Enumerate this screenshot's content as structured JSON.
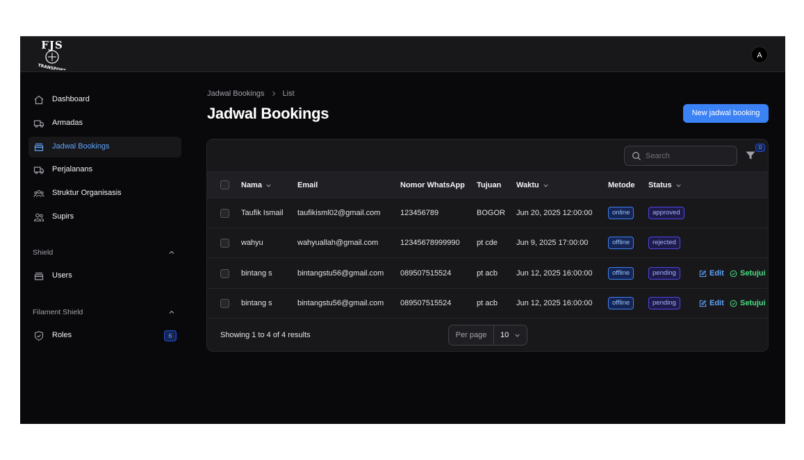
{
  "brand": {
    "logo_main": "FJS",
    "logo_sub": "TRANSPORT"
  },
  "user": {
    "avatar_initial": "A"
  },
  "sidebar": {
    "items": [
      {
        "label": "Dashboard",
        "icon": "home-icon"
      },
      {
        "label": "Armadas",
        "icon": "truck-icon"
      },
      {
        "label": "Jadwal Bookings",
        "icon": "inbox-icon",
        "active": true
      },
      {
        "label": "Perjalanans",
        "icon": "truck-icon"
      },
      {
        "label": "Struktur Organisasis",
        "icon": "users-group-icon"
      },
      {
        "label": "Supirs",
        "icon": "users-icon"
      }
    ],
    "groups": [
      {
        "label": "Shield",
        "items": [
          {
            "label": "Users",
            "icon": "inbox-icon"
          }
        ]
      },
      {
        "label": "Filament Shield",
        "items": [
          {
            "label": "Roles",
            "icon": "shield-check-icon",
            "badge": "6"
          }
        ]
      }
    ]
  },
  "breadcrumb": {
    "parent": "Jadwal Bookings",
    "current": "List"
  },
  "page": {
    "title": "Jadwal Bookings",
    "new_button": "New jadwal booking"
  },
  "table": {
    "search_placeholder": "Search",
    "filter_count": "0",
    "columns": [
      "Nama",
      "Email",
      "Nomor WhatsApp",
      "Tujuan",
      "Waktu",
      "Metode",
      "Status"
    ],
    "rows": [
      {
        "nama": "Taufik Ismail",
        "email": "taufikisml02@gmail.com",
        "whatsapp": "123456789",
        "tujuan": "BOGOR",
        "waktu": "Jun 20, 2025 12:00:00",
        "metode": "online",
        "status": "approved"
      },
      {
        "nama": "wahyu",
        "email": "wahyuallah@gmail.com",
        "whatsapp": "12345678999990",
        "tujuan": "pt cde",
        "waktu": "Jun 9, 2025 17:00:00",
        "metode": "offline",
        "status": "rejected"
      },
      {
        "nama": "bintang s",
        "email": "bintangstu56@gmail.com",
        "whatsapp": "089507515524",
        "tujuan": "pt acb",
        "waktu": "Jun 12, 2025 16:00:00",
        "metode": "offline",
        "status": "pending",
        "actions": [
          "Edit",
          "Setujui"
        ]
      },
      {
        "nama": "bintang s",
        "email": "bintangstu56@gmail.com",
        "whatsapp": "089507515524",
        "tujuan": "pt acb",
        "waktu": "Jun 12, 2025 16:00:00",
        "metode": "offline",
        "status": "pending",
        "actions": [
          "Edit",
          "Setujui"
        ]
      }
    ],
    "footer": {
      "showing": "Showing 1 to 4 of 4 results",
      "per_page_label": "Per page",
      "per_page_value": "10"
    }
  },
  "colors": {
    "accent": "#3b82f6",
    "background": "#09090b",
    "surface": "#18181b",
    "approve": "#4ade80"
  }
}
